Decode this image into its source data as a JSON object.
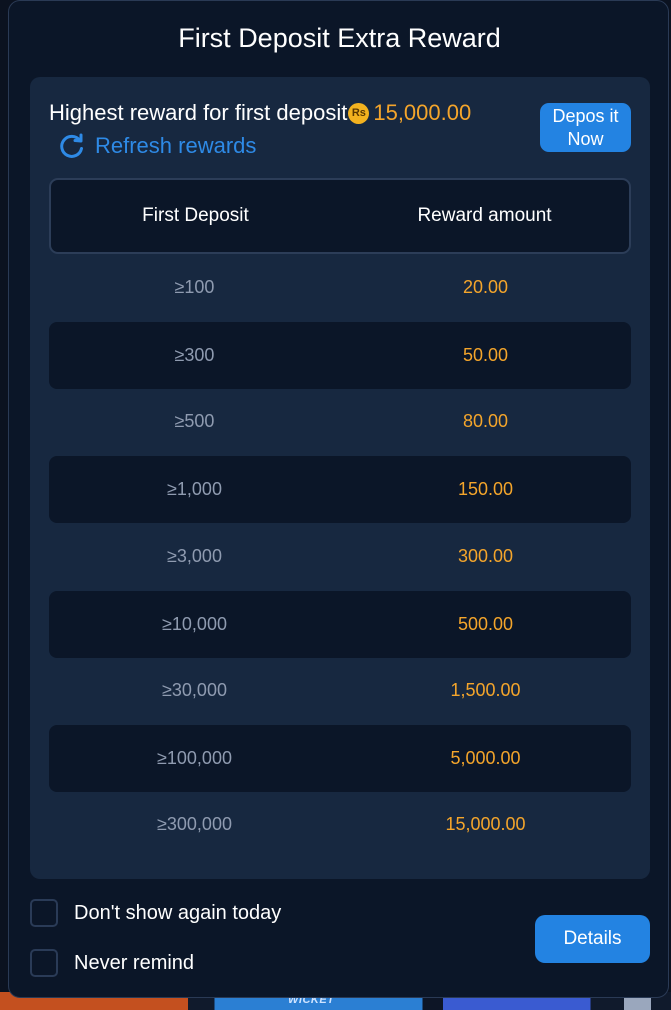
{
  "modal": {
    "title": "First Deposit Extra Reward",
    "highest_label": "Highest reward for first deposit",
    "currency_icon": "Rs",
    "highest_amount": "15,000.00",
    "refresh_label": "Refresh rewards",
    "deposit_button": "Depos it Now",
    "table": {
      "headers": [
        "First Deposit",
        "Reward amount"
      ],
      "rows": [
        {
          "deposit": "≥100",
          "reward": "20.00"
        },
        {
          "deposit": "≥300",
          "reward": "50.00"
        },
        {
          "deposit": "≥500",
          "reward": "80.00"
        },
        {
          "deposit": "≥1,000",
          "reward": "150.00"
        },
        {
          "deposit": "≥3,000",
          "reward": "300.00"
        },
        {
          "deposit": "≥10,000",
          "reward": "500.00"
        },
        {
          "deposit": "≥30,000",
          "reward": "1,500.00"
        },
        {
          "deposit": "≥100,000",
          "reward": "5,000.00"
        },
        {
          "deposit": "≥300,000",
          "reward": "15,000.00"
        }
      ]
    },
    "dont_show_label": "Don't show again today",
    "never_remind_label": "Never remind",
    "details_button": "Details"
  },
  "background": {
    "watermark": "WICKET"
  },
  "colors": {
    "accent": "#2383e2",
    "reward": "#f4a52b",
    "panel": "#172840",
    "modal": "#0b1628"
  }
}
